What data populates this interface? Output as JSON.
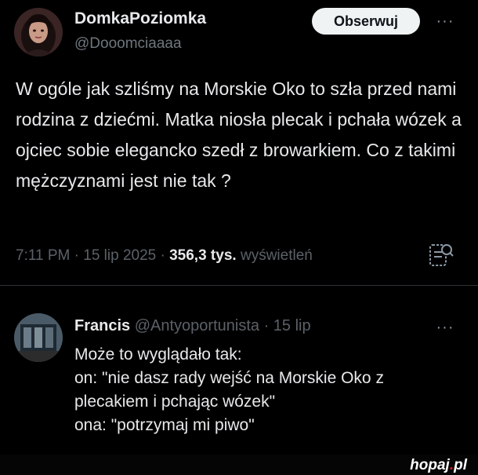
{
  "tweet": {
    "author_name": "DomkaPoziomka",
    "author_handle": "@Dooomciaaaa",
    "follow_label": "Obserwuj",
    "more_glyph": "···",
    "text": "W ogóle jak szliśmy na Morskie Oko to szła przed nami rodzina z dziećmi. Matka niosła plecak i pchała wózek a ojciec sobie elegancko szedł z browarkiem. Co z takimi mężczyznami jest nie tak ?",
    "time": "7:11 PM",
    "separator": "·",
    "date": "15 lip 2025",
    "views_count": "356,3 tys.",
    "views_label": "wyświetleń",
    "analytics_icon": "analytics-icon"
  },
  "reply": {
    "name": "Francis",
    "handle": "@Antyoportunista",
    "separator": "·",
    "date": "15 lip",
    "more_glyph": "···",
    "lines": [
      "Może to wyglądało tak:",
      "on: \"nie dasz rady wejść na Morskie Oko z",
      "plecakiem i pchając wózek\"",
      "ona: \"potrzymaj mi piwo\""
    ]
  },
  "watermark": {
    "main": "hopaj",
    "dot": ".",
    "tld": "pl"
  },
  "colors": {
    "background": "#000000",
    "text": "#e7e9ea",
    "secondary": "#6e767d",
    "follow_bg": "#eff3f4",
    "watermark_accent": "#e0161b"
  }
}
